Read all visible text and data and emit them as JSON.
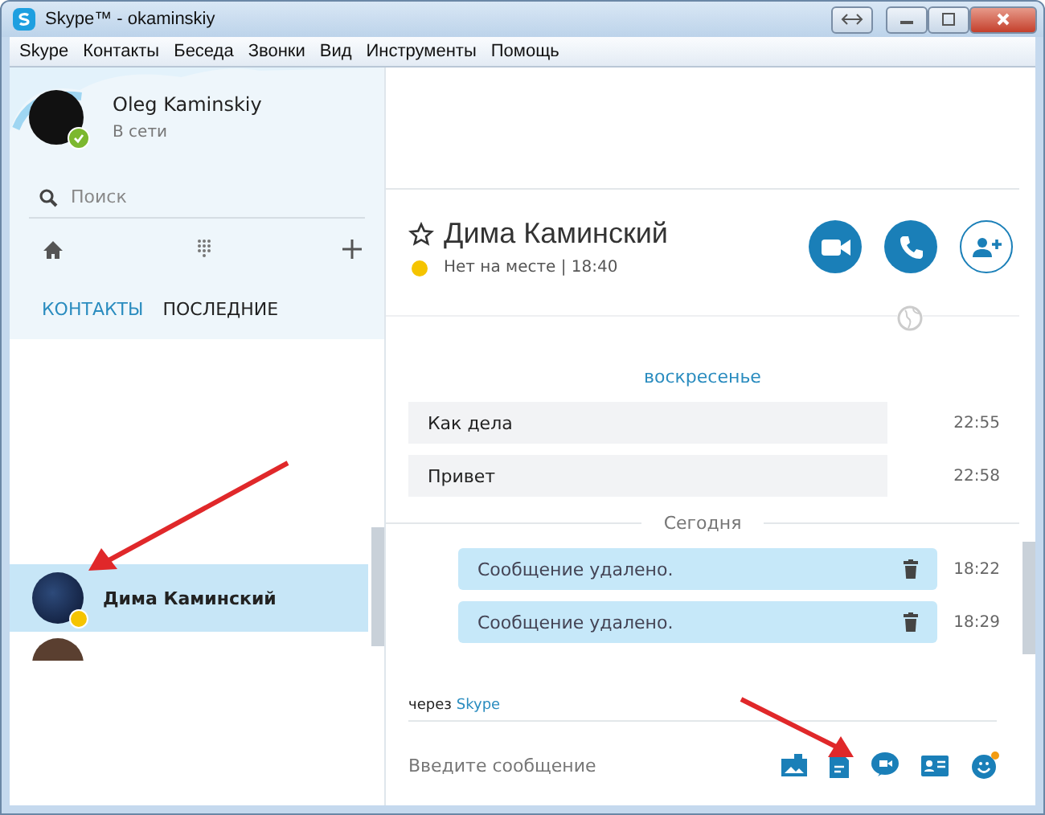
{
  "window": {
    "title": "Skype™ - okaminskiy"
  },
  "menu": [
    "Skype",
    "Контакты",
    "Беседа",
    "Звонки",
    "Вид",
    "Инструменты",
    "Помощь"
  ],
  "profile": {
    "name": "Oleg Kaminskiy",
    "status": "В сети",
    "online": true
  },
  "search": {
    "placeholder": "Поиск"
  },
  "tabs": [
    {
      "label": "КОНТАКТЫ",
      "selected": true
    },
    {
      "label": "ПОСЛЕДНИЕ",
      "selected": false
    }
  ],
  "contacts": [
    {
      "name": "Дима Каминский",
      "selected": true,
      "away": true
    }
  ],
  "chat": {
    "name": "Дима Каминский",
    "away": true,
    "status_text": "Нет на месте | 18:40"
  },
  "messages": [
    {
      "kind": "day",
      "text": "воскресенье",
      "highlight": true
    },
    {
      "kind": "incoming",
      "text": "Как дела",
      "time": "22:55"
    },
    {
      "kind": "incoming",
      "text": "Привет",
      "time": "22:58"
    },
    {
      "kind": "day",
      "text": "Сегодня",
      "highlight": false
    },
    {
      "kind": "outgoing",
      "text": "Сообщение удалено.",
      "time": "18:22"
    },
    {
      "kind": "outgoing",
      "text": "Сообщение удалено.",
      "time": "18:29"
    }
  ],
  "footer": {
    "via": "через",
    "via_link": "Skype",
    "placeholder": "Введите сообщение"
  }
}
